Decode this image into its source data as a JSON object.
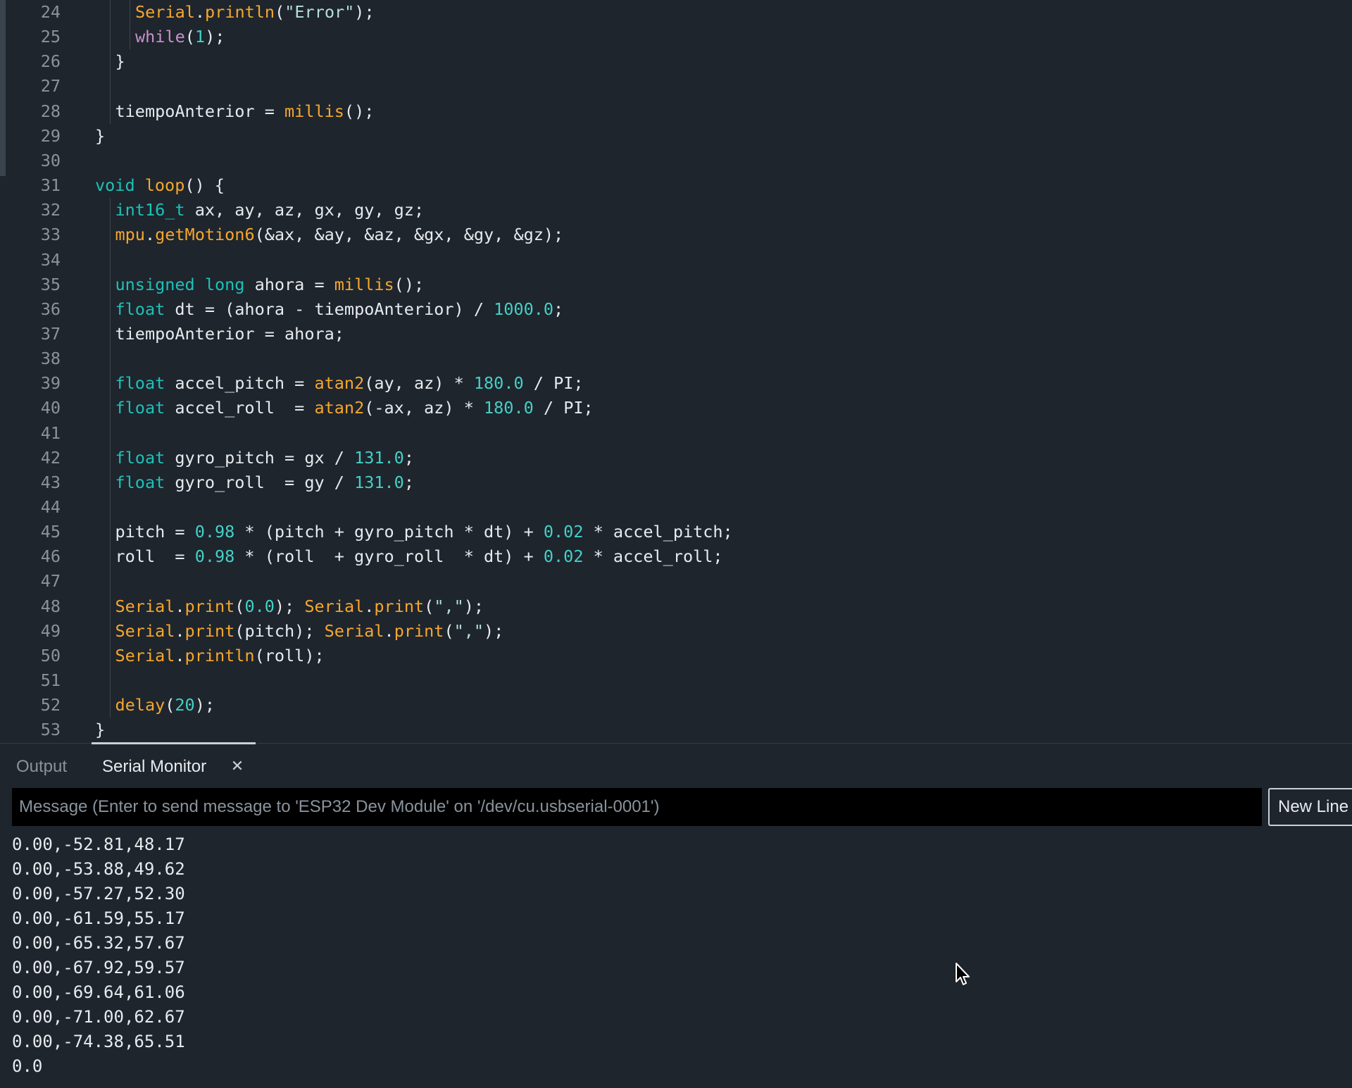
{
  "editor": {
    "lines": [
      {
        "n": "24",
        "indent": 2,
        "tokens": [
          {
            "t": "Serial",
            "c": "fn"
          },
          {
            "t": ".",
            "c": ""
          },
          {
            "t": "println",
            "c": "fn"
          },
          {
            "t": "(",
            "c": ""
          },
          {
            "t": "\"Error\"",
            "c": "str"
          },
          {
            "t": ");",
            "c": ""
          }
        ]
      },
      {
        "n": "25",
        "indent": 2,
        "tokens": [
          {
            "t": "while",
            "c": "ctl"
          },
          {
            "t": "(",
            "c": ""
          },
          {
            "t": "1",
            "c": "num"
          },
          {
            "t": ");",
            "c": ""
          }
        ]
      },
      {
        "n": "26",
        "indent": 1,
        "tokens": [
          {
            "t": "}",
            "c": ""
          }
        ]
      },
      {
        "n": "27",
        "indent": 0,
        "tokens": []
      },
      {
        "n": "28",
        "indent": 1,
        "tokens": [
          {
            "t": "tiempoAnterior = ",
            "c": ""
          },
          {
            "t": "millis",
            "c": "fn"
          },
          {
            "t": "();",
            "c": ""
          }
        ]
      },
      {
        "n": "29",
        "indent": 0,
        "tokens": [
          {
            "t": "}",
            "c": ""
          }
        ]
      },
      {
        "n": "30",
        "indent": 0,
        "tokens": []
      },
      {
        "n": "31",
        "indent": 0,
        "tokens": [
          {
            "t": "void",
            "c": "kw"
          },
          {
            "t": " ",
            "c": ""
          },
          {
            "t": "loop",
            "c": "fn"
          },
          {
            "t": "() {",
            "c": ""
          }
        ]
      },
      {
        "n": "32",
        "indent": 1,
        "tokens": [
          {
            "t": "int16_t",
            "c": "kw"
          },
          {
            "t": " ax, ay, az, gx, gy, gz;",
            "c": ""
          }
        ]
      },
      {
        "n": "33",
        "indent": 1,
        "tokens": [
          {
            "t": "mpu",
            "c": "fn"
          },
          {
            "t": ".",
            "c": ""
          },
          {
            "t": "getMotion6",
            "c": "fn"
          },
          {
            "t": "(&ax, &ay, &az, &gx, &gy, &gz);",
            "c": ""
          }
        ]
      },
      {
        "n": "34",
        "indent": 0,
        "tokens": []
      },
      {
        "n": "35",
        "indent": 1,
        "tokens": [
          {
            "t": "unsigned",
            "c": "kw"
          },
          {
            "t": " ",
            "c": ""
          },
          {
            "t": "long",
            "c": "kw"
          },
          {
            "t": " ahora = ",
            "c": ""
          },
          {
            "t": "millis",
            "c": "fn"
          },
          {
            "t": "();",
            "c": ""
          }
        ]
      },
      {
        "n": "36",
        "indent": 1,
        "tokens": [
          {
            "t": "float",
            "c": "kw"
          },
          {
            "t": " dt = (ahora - tiempoAnterior) / ",
            "c": ""
          },
          {
            "t": "1000.0",
            "c": "num"
          },
          {
            "t": ";",
            "c": ""
          }
        ]
      },
      {
        "n": "37",
        "indent": 1,
        "tokens": [
          {
            "t": "tiempoAnterior = ahora;",
            "c": ""
          }
        ]
      },
      {
        "n": "38",
        "indent": 0,
        "tokens": []
      },
      {
        "n": "39",
        "indent": 1,
        "tokens": [
          {
            "t": "float",
            "c": "kw"
          },
          {
            "t": " accel_pitch = ",
            "c": ""
          },
          {
            "t": "atan2",
            "c": "fn"
          },
          {
            "t": "(ay, az) * ",
            "c": ""
          },
          {
            "t": "180.0",
            "c": "num"
          },
          {
            "t": " / PI;",
            "c": ""
          }
        ]
      },
      {
        "n": "40",
        "indent": 1,
        "tokens": [
          {
            "t": "float",
            "c": "kw"
          },
          {
            "t": " accel_roll  = ",
            "c": ""
          },
          {
            "t": "atan2",
            "c": "fn"
          },
          {
            "t": "(-ax, az) * ",
            "c": ""
          },
          {
            "t": "180.0",
            "c": "num"
          },
          {
            "t": " / PI;",
            "c": ""
          }
        ]
      },
      {
        "n": "41",
        "indent": 0,
        "tokens": []
      },
      {
        "n": "42",
        "indent": 1,
        "tokens": [
          {
            "t": "float",
            "c": "kw"
          },
          {
            "t": " gyro_pitch = gx / ",
            "c": ""
          },
          {
            "t": "131.0",
            "c": "num"
          },
          {
            "t": ";",
            "c": ""
          }
        ]
      },
      {
        "n": "43",
        "indent": 1,
        "tokens": [
          {
            "t": "float",
            "c": "kw"
          },
          {
            "t": " gyro_roll  = gy / ",
            "c": ""
          },
          {
            "t": "131.0",
            "c": "num"
          },
          {
            "t": ";",
            "c": ""
          }
        ]
      },
      {
        "n": "44",
        "indent": 0,
        "tokens": []
      },
      {
        "n": "45",
        "indent": 1,
        "tokens": [
          {
            "t": "pitch = ",
            "c": ""
          },
          {
            "t": "0.98",
            "c": "num"
          },
          {
            "t": " * (pitch + gyro_pitch * dt) + ",
            "c": ""
          },
          {
            "t": "0.02",
            "c": "num"
          },
          {
            "t": " * accel_pitch;",
            "c": ""
          }
        ]
      },
      {
        "n": "46",
        "indent": 1,
        "tokens": [
          {
            "t": "roll  = ",
            "c": ""
          },
          {
            "t": "0.98",
            "c": "num"
          },
          {
            "t": " * (roll  + gyro_roll  * dt) + ",
            "c": ""
          },
          {
            "t": "0.02",
            "c": "num"
          },
          {
            "t": " * accel_roll;",
            "c": ""
          }
        ]
      },
      {
        "n": "47",
        "indent": 0,
        "tokens": []
      },
      {
        "n": "48",
        "indent": 1,
        "tokens": [
          {
            "t": "Serial",
            "c": "fn"
          },
          {
            "t": ".",
            "c": ""
          },
          {
            "t": "print",
            "c": "fn"
          },
          {
            "t": "(",
            "c": ""
          },
          {
            "t": "0.0",
            "c": "num"
          },
          {
            "t": "); ",
            "c": ""
          },
          {
            "t": "Serial",
            "c": "fn"
          },
          {
            "t": ".",
            "c": ""
          },
          {
            "t": "print",
            "c": "fn"
          },
          {
            "t": "(",
            "c": ""
          },
          {
            "t": "\",\"",
            "c": "str"
          },
          {
            "t": ");",
            "c": ""
          }
        ]
      },
      {
        "n": "49",
        "indent": 1,
        "tokens": [
          {
            "t": "Serial",
            "c": "fn"
          },
          {
            "t": ".",
            "c": ""
          },
          {
            "t": "print",
            "c": "fn"
          },
          {
            "t": "(pitch); ",
            "c": ""
          },
          {
            "t": "Serial",
            "c": "fn"
          },
          {
            "t": ".",
            "c": ""
          },
          {
            "t": "print",
            "c": "fn"
          },
          {
            "t": "(",
            "c": ""
          },
          {
            "t": "\",\"",
            "c": "str"
          },
          {
            "t": ");",
            "c": ""
          }
        ]
      },
      {
        "n": "50",
        "indent": 1,
        "tokens": [
          {
            "t": "Serial",
            "c": "fn"
          },
          {
            "t": ".",
            "c": ""
          },
          {
            "t": "println",
            "c": "fn"
          },
          {
            "t": "(roll);",
            "c": ""
          }
        ]
      },
      {
        "n": "51",
        "indent": 0,
        "tokens": []
      },
      {
        "n": "52",
        "indent": 1,
        "tokens": [
          {
            "t": "delay",
            "c": "fn"
          },
          {
            "t": "(",
            "c": ""
          },
          {
            "t": "20",
            "c": "num"
          },
          {
            "t": ");",
            "c": ""
          }
        ]
      },
      {
        "n": "53",
        "indent": 0,
        "tokens": [
          {
            "t": "}",
            "c": ""
          }
        ]
      }
    ]
  },
  "panel": {
    "tabs": {
      "output_label": "Output",
      "serial_label": "Serial Monitor"
    },
    "message_placeholder": "Message (Enter to send message to 'ESP32 Dev Module' on '/dev/cu.usbserial-0001')",
    "line_ending": "New Line",
    "serial_output": [
      "0.00,-52.81,48.17",
      "0.00,-53.88,49.62",
      "0.00,-57.27,52.30",
      "0.00,-61.59,55.17",
      "0.00,-65.32,57.67",
      "0.00,-67.92,59.57",
      "0.00,-69.64,61.06",
      "0.00,-71.00,62.67",
      "0.00,-74.38,65.51",
      "0.0"
    ]
  },
  "icons": {
    "close": "close-icon",
    "cursor": "mouse-pointer-icon"
  },
  "colors": {
    "background": "#1e252d",
    "keyword": "#1ec1b7",
    "function": "#f6a72e",
    "number": "#45d0c6",
    "string": "#b6dfd9",
    "control": "#c990c9",
    "text": "#e8ebee",
    "line_number": "#8a939c"
  }
}
